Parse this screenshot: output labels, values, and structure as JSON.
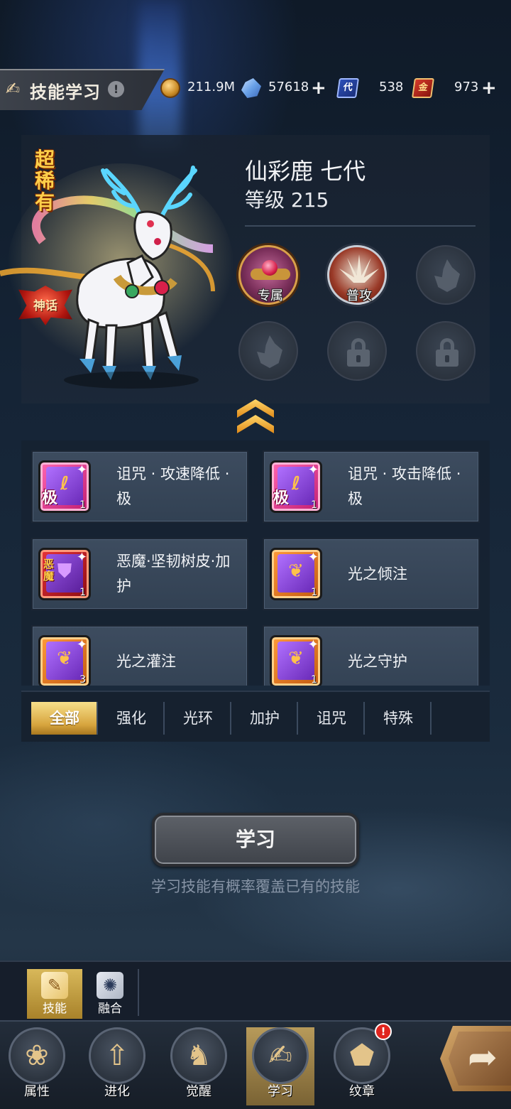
{
  "header": {
    "title": "技能学习",
    "help_icon": "exclamation-icon",
    "resources": [
      {
        "icon": "gold-coin-icon",
        "value": "211.9M",
        "addable": false
      },
      {
        "icon": "crystal-icon",
        "value": "57618",
        "addable": true
      },
      {
        "icon": "blue-card-icon",
        "icon_text": "代",
        "value": "538",
        "addable": false
      },
      {
        "icon": "red-card-icon",
        "icon_text": "金",
        "value": "973",
        "addable": true
      }
    ]
  },
  "hero": {
    "rarity": "超稀有",
    "badge": "神话",
    "name": "仙彩鹿 七代",
    "level": "等级 215",
    "skill_slots": [
      {
        "type": "exclusive",
        "label": "专属"
      },
      {
        "type": "normal-attack",
        "label": "普攻"
      },
      {
        "type": "empty",
        "label": ""
      },
      {
        "type": "empty",
        "label": ""
      },
      {
        "type": "locked",
        "label": ""
      },
      {
        "type": "locked",
        "label": ""
      }
    ]
  },
  "skill_list": [
    {
      "name": "诅咒 · 攻速降低 · 极",
      "book": "pink",
      "tag": "极",
      "count": "1"
    },
    {
      "name": "诅咒 · 攻击降低 · 极",
      "book": "pink",
      "tag": "极",
      "count": "1"
    },
    {
      "name": "恶魔·坚韧树皮·加护",
      "book": "red",
      "tag": "恶魔",
      "count": "1"
    },
    {
      "name": "光之倾注",
      "book": "orange",
      "tag": "",
      "count": "1"
    },
    {
      "name": "光之灌注",
      "book": "orange",
      "tag": "",
      "count": "3"
    },
    {
      "name": "光之守护",
      "book": "orange",
      "tag": "",
      "count": "1"
    }
  ],
  "filters": [
    "全部",
    "强化",
    "光环",
    "加护",
    "诅咒",
    "特殊"
  ],
  "active_filter": 0,
  "learn_button": "学习",
  "learn_hint": "学习技能有概率覆盖已有的技能",
  "sub_tabs": [
    {
      "label": "技能",
      "icon": "skill-book-icon",
      "active": true
    },
    {
      "label": "融合",
      "icon": "swirl-icon",
      "active": false
    }
  ],
  "bottom_nav": [
    {
      "label": "属性",
      "icon": "paw-icon",
      "active": false
    },
    {
      "label": "进化",
      "icon": "arrow-up-icon",
      "active": false
    },
    {
      "label": "觉醒",
      "icon": "fox-mask-icon",
      "active": false
    },
    {
      "label": "学习",
      "icon": "claw-icon",
      "active": true
    },
    {
      "label": "纹章",
      "icon": "emblem-icon",
      "active": false,
      "badge": "!"
    }
  ],
  "next_button_icon": "arrow-right-icon",
  "colors": {
    "accent_gold": "#d7a53e",
    "badge_red": "#e0251f",
    "panel": "#324153"
  }
}
